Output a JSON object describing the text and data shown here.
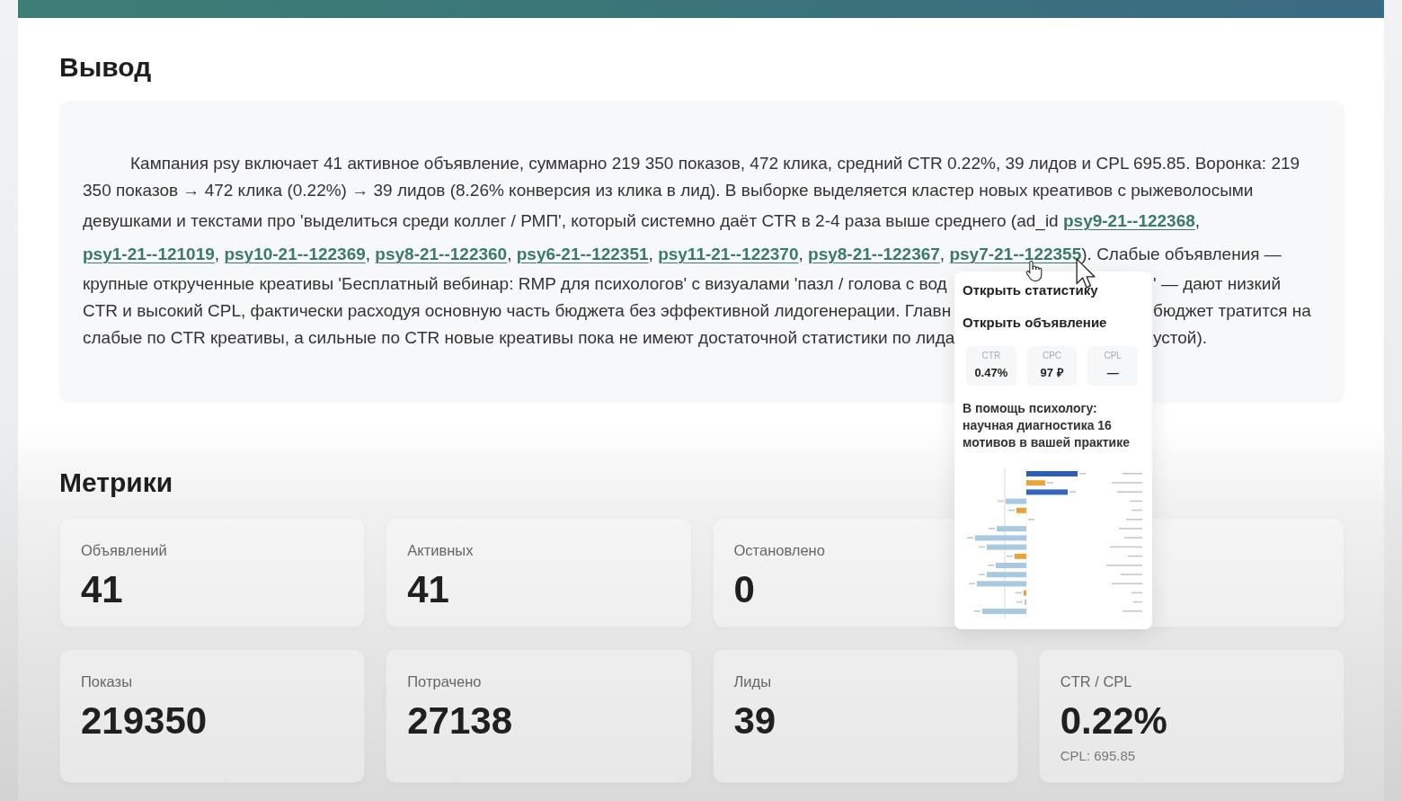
{
  "conclusion": {
    "title": "Вывод",
    "lines": [
      {
        "segments": [
          {
            "kind": "text",
            "text": "Кампания psy включает 41 активное объявление, суммарно 219 350 показов, 472 клика, средний CTR 0.22%, 39 лидов и CPL 695.85. Воронка: 219"
          }
        ]
      },
      {
        "segments": [
          {
            "kind": "text",
            "text": "350 показов → 472 клика (0.22%) → 39 лидов (8.26% конверсия из клика в лид). В выборке выделяется кластер новых креативов с рыжеволосыми"
          }
        ]
      },
      {
        "segments": [
          {
            "kind": "text",
            "text": "девушками и текстами про 'выделиться среди коллег / РМП', который системно даёт CTR в 2-4 раза выше среднего (ad_id "
          },
          {
            "kind": "link",
            "text": "psy9-21--122368"
          },
          {
            "kind": "text",
            "text": ","
          }
        ]
      },
      {
        "segments": [
          {
            "kind": "link",
            "text": "psy1-21--121019"
          },
          {
            "kind": "text",
            "text": ", "
          },
          {
            "kind": "link",
            "text": "psy10-21--122369"
          },
          {
            "kind": "text",
            "text": ", "
          },
          {
            "kind": "link",
            "text": "psy8-21--122360"
          },
          {
            "kind": "text",
            "text": ", "
          },
          {
            "kind": "link",
            "text": "psy6-21--122351"
          },
          {
            "kind": "text",
            "text": ", "
          },
          {
            "kind": "link",
            "text": "psy11-21--122370"
          },
          {
            "kind": "text",
            "text": ", "
          },
          {
            "kind": "link",
            "text": "psy8-21--122367"
          },
          {
            "kind": "text",
            "text": ", "
          },
          {
            "kind": "link",
            "text": "psy7-21--122355"
          },
          {
            "kind": "text",
            "text": "). Слабые объявления —"
          }
        ]
      },
      {
        "segments": [
          {
            "kind": "text",
            "text": "крупные открученные креативы 'Бесплатный вебинар: RMP для психологов' с визуалами 'пазл / голова с вод"
          },
          {
            "kind": "covered"
          },
          {
            "kind": "text",
            "text": "' — дают низкий"
          }
        ]
      },
      {
        "segments": [
          {
            "kind": "text",
            "text": "CTR и высокий CPL, фактически расходуя основную часть бюджета без эффективной лидогенерации. Главн"
          },
          {
            "kind": "covered"
          },
          {
            "kind": "text",
            "text": "бюджет тратится на"
          }
        ]
      },
      {
        "segments": [
          {
            "kind": "text",
            "text": "слабые по CTR креативы, а сильные по CTR новые креативы пока не имеют достаточной статистики по лида"
          },
          {
            "kind": "covered"
          },
          {
            "kind": "text",
            "text": "устой)."
          }
        ]
      }
    ]
  },
  "ad_popover": {
    "menu": [
      "Открыть статистику",
      "Открыть объявление"
    ],
    "stats": [
      {
        "label": "CTR",
        "value": "0.47%"
      },
      {
        "label": "CPC",
        "value": "97 ₽"
      },
      {
        "label": "CPL",
        "value": "—"
      }
    ],
    "ad_title": "В помощь психологу: научная диагностика 16 мотивов в вашей практике"
  },
  "metrics": {
    "title": "Метрики",
    "cards": [
      {
        "kind": "stat",
        "label": "Объявлений",
        "value": "41"
      },
      {
        "kind": "stat",
        "label": "Активных",
        "value": "41"
      },
      {
        "kind": "stat",
        "label": "Остановлено",
        "value": "0"
      },
      {
        "kind": "covered"
      },
      {
        "kind": "stat",
        "label": "Показы",
        "value": "219350"
      },
      {
        "kind": "stat",
        "label": "Потрачено",
        "value": "27138"
      },
      {
        "kind": "stat",
        "label": "Лиды",
        "value": "39"
      },
      {
        "kind": "stat",
        "label": "CTR / CPL",
        "value": "0.22%",
        "note": "CPL: 695.85"
      }
    ]
  }
}
